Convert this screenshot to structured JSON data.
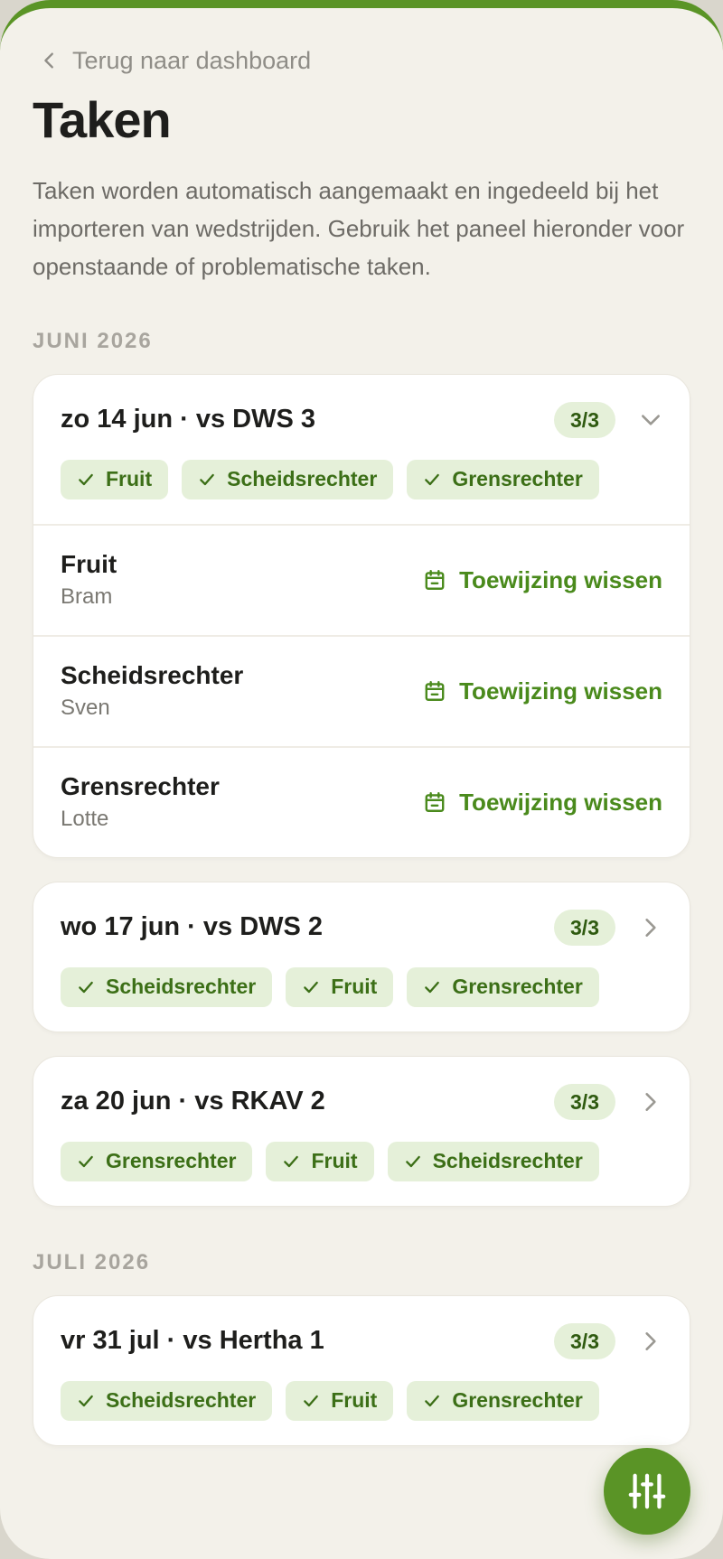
{
  "nav": {
    "back_label": "Terug naar dashboard"
  },
  "page": {
    "title": "Taken",
    "intro": "Taken worden automatisch aangemaakt en ingedeeld bij het importeren van wedstrijden. Gebruik het paneel hieronder voor openstaande of problematische taken."
  },
  "sections": [
    {
      "label": "JUNI 2026",
      "cards": [
        {
          "match": "zo 14 jun · vs DWS 3",
          "count": "3/3",
          "expanded": true,
          "chips": [
            "Fruit",
            "Scheidsrechter",
            "Grensrechter"
          ],
          "rows": [
            {
              "task": "Fruit",
              "assignee": "Bram",
              "action": "Toewijzing wissen"
            },
            {
              "task": "Scheidsrechter",
              "assignee": "Sven",
              "action": "Toewijzing wissen"
            },
            {
              "task": "Grensrechter",
              "assignee": "Lotte",
              "action": "Toewijzing wissen"
            }
          ]
        },
        {
          "match": "wo 17 jun · vs DWS 2",
          "count": "3/3",
          "expanded": false,
          "chips": [
            "Scheidsrechter",
            "Fruit",
            "Grensrechter"
          ]
        },
        {
          "match": "za 20 jun · vs RKAV 2",
          "count": "3/3",
          "expanded": false,
          "chips": [
            "Grensrechter",
            "Fruit",
            "Scheidsrechter"
          ]
        }
      ]
    },
    {
      "label": "JULI 2026",
      "cards": [
        {
          "match": "vr 31 jul · vs Hertha 1",
          "count": "3/3",
          "expanded": false,
          "chips": [
            "Scheidsrechter",
            "Fruit",
            "Grensrechter"
          ]
        }
      ]
    }
  ],
  "icons": {
    "back": "chevron-left-icon",
    "expand": "chevron-down-icon",
    "collapsed": "chevron-right-icon",
    "chip": "check-icon",
    "action": "calendar-remove-icon",
    "fab": "sliders-icon"
  },
  "colors": {
    "accent": "#5a9426",
    "chip_bg": "#e5f0d9",
    "background": "#f3f1ea"
  }
}
